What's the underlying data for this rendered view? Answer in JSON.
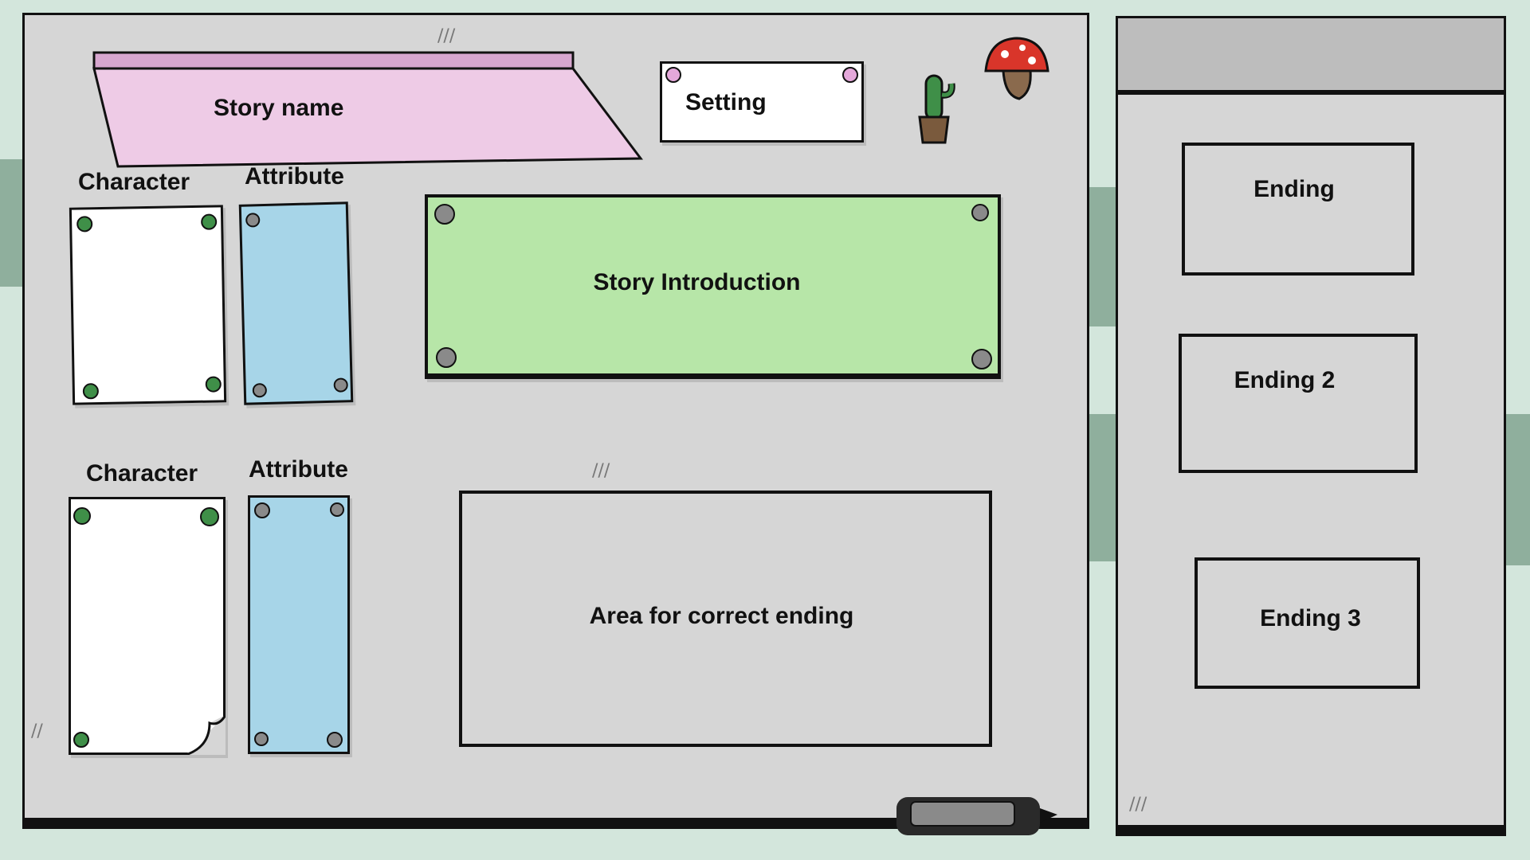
{
  "board": {
    "story_name": "Story name",
    "setting": "Setting",
    "character_1": "Character",
    "attribute_1": "Attribute",
    "character_2": "Character",
    "attribute_2": "Attribute",
    "story_introduction": "Story Introduction",
    "correct_ending_area": "Area for correct ending"
  },
  "endings_panel": {
    "items": [
      {
        "label": "Ending"
      },
      {
        "label": "Ending 2"
      },
      {
        "label": "Ending 3"
      }
    ]
  },
  "colors": {
    "background": "#d3e6dc",
    "board": "#d6d6d6",
    "story_name_banner": "#eecbe6",
    "intro_note": "#b7e6a8",
    "attribute_note": "#a7d5e8",
    "character_note": "#ffffff"
  },
  "icons": [
    "cactus-icon",
    "mushroom-icon",
    "marker-icon",
    "pushpin-icon"
  ]
}
